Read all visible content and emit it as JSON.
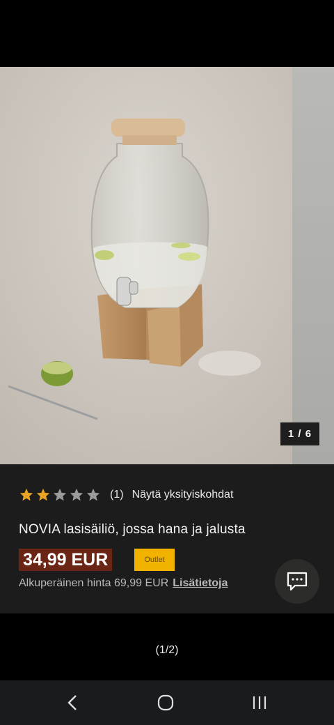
{
  "gallery": {
    "image_alt": "NOVIA lasisäiliö, jossa hana ja jalusta",
    "counter": "1 / 6"
  },
  "product": {
    "rating": 2,
    "rating_max": 5,
    "rating_count": "(1)",
    "details_link": "Näytä yksityiskohdat",
    "title": "NOVIA lasisäiliö, jossa hana ja jalusta",
    "price": "34,99 EUR",
    "badge": "Outlet",
    "original_price_text": "Alkuperäinen hinta 69,99 EUR",
    "more_info_link": "Lisätietoja"
  },
  "chat": {
    "icon": "chat-icon"
  },
  "pager": {
    "text": "(1/2)"
  },
  "colors": {
    "price_bg": "#6b2514",
    "badge_bg": "#f2b300",
    "star_filled": "#e8a323",
    "star_empty": "#9a9a9a"
  },
  "navbar": {
    "back": "back-icon",
    "home": "home-icon",
    "recents": "recents-icon"
  }
}
